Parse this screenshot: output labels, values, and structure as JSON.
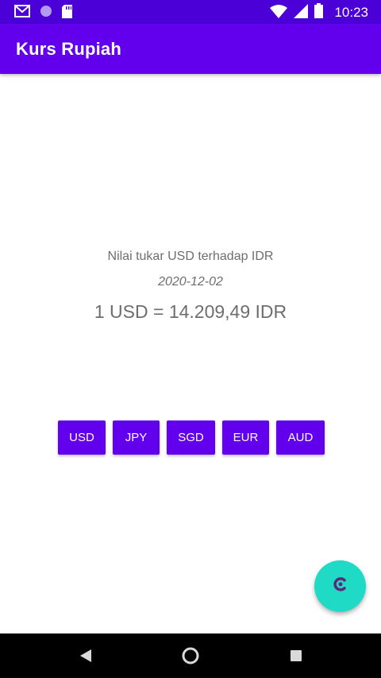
{
  "status_bar": {
    "time": "10:23",
    "icons_left": [
      "gmail-icon",
      "circle-icon",
      "sd-card-icon"
    ],
    "icons_right": [
      "wifi-icon",
      "signal-icon",
      "battery-icon"
    ]
  },
  "app_bar": {
    "title": "Kurs Rupiah"
  },
  "content": {
    "rate_label": "Nilai tukar USD terhadap IDR",
    "rate_date": "2020-12-02",
    "rate_value": "1 USD = 14.209,49 IDR"
  },
  "currency_buttons": [
    "USD",
    "JPY",
    "SGD",
    "EUR",
    "AUD"
  ],
  "fab": {
    "icon": "refresh-icon"
  },
  "nav_bar": {
    "icons": [
      "back-icon",
      "home-icon",
      "recents-icon"
    ]
  },
  "colors": {
    "status_bar": "#4a00d6",
    "primary": "#6200ee",
    "fab": "#1fdbc5",
    "text_secondary": "#6e6e6e"
  }
}
